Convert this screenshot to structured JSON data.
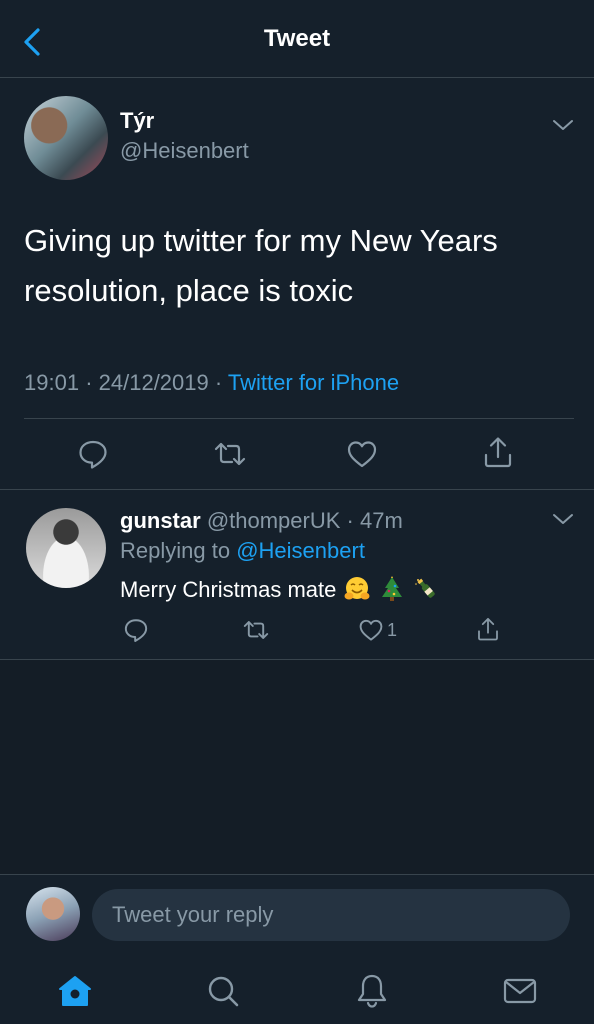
{
  "header": {
    "title": "Tweet"
  },
  "tweet": {
    "author_name": "Týr",
    "author_handle": "@Heisenbert",
    "text": "Giving up twitter for my New Years resolution, place is toxic",
    "time": "19:01",
    "date": "24/12/2019",
    "source": "Twitter for iPhone"
  },
  "reply": {
    "name": "gunstar",
    "handle": "@thomperUK",
    "time": "47m",
    "replying_label": "Replying to",
    "replying_to": "@Heisenbert",
    "text": "Merry Christmas mate",
    "emojis": [
      "hugging-face",
      "christmas-tree",
      "champagne-bottle"
    ],
    "like_count": "1"
  },
  "composer": {
    "placeholder": "Tweet your reply"
  },
  "tabbar": {
    "items": [
      "home-icon",
      "search-icon",
      "notifications-icon",
      "messages-icon"
    ]
  },
  "colors": {
    "background": "#15202b",
    "accent": "#1da1f2",
    "secondary_text": "#8899a6",
    "divider": "#38444d"
  }
}
